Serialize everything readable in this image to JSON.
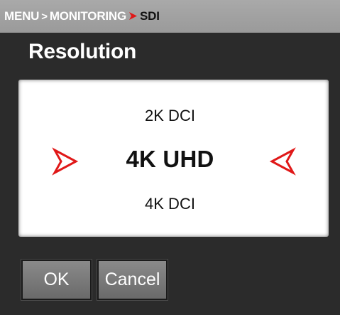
{
  "breadcrumb": {
    "items": [
      "MENU",
      "MONITORING",
      "SDI"
    ],
    "separator": ">"
  },
  "page": {
    "title": "Resolution"
  },
  "picker": {
    "previous_option": "2K DCI",
    "current_option": "4K UHD",
    "next_option": "4K DCI"
  },
  "buttons": {
    "ok_label": "OK",
    "cancel_label": "Cancel"
  },
  "colors": {
    "accent": "#e01818",
    "background": "#2b2b2b",
    "header": "#a3a3a3"
  },
  "icons": {
    "left": "chevron-right-icon",
    "right": "chevron-left-icon"
  }
}
